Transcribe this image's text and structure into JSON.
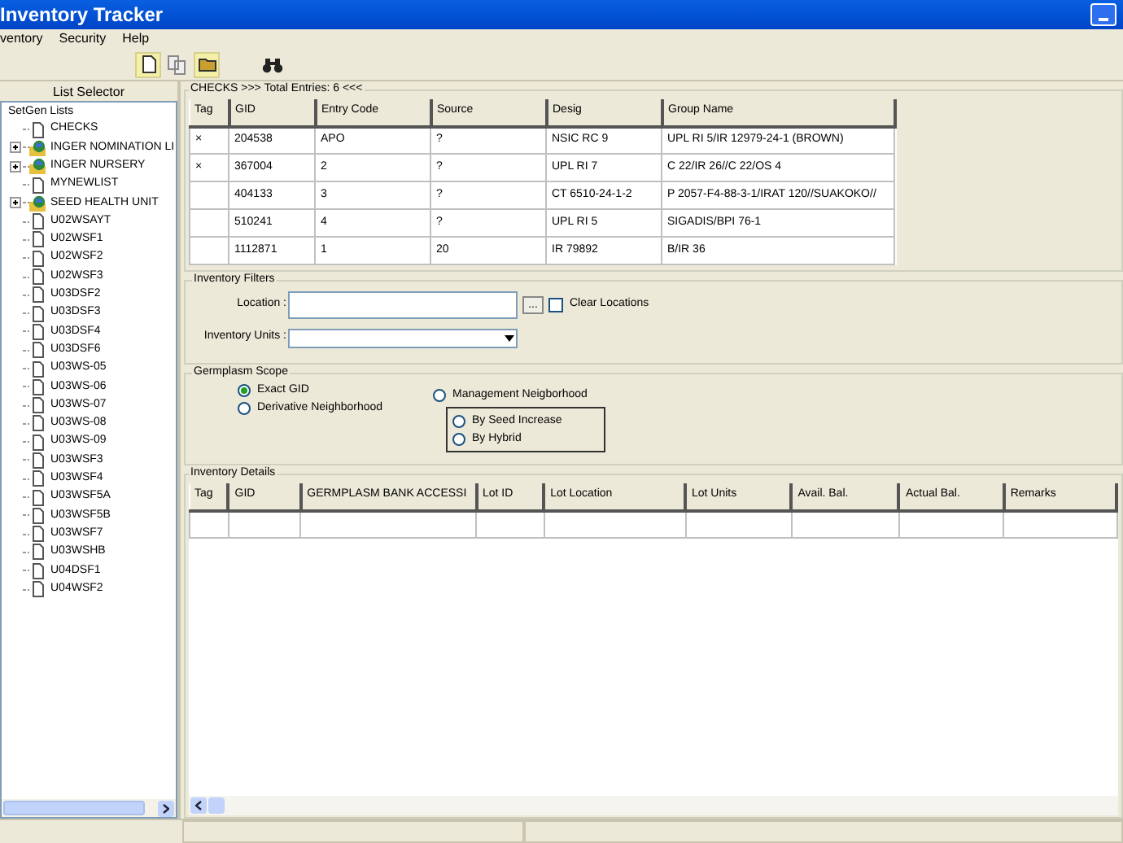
{
  "window": {
    "title": "Inventory Tracker"
  },
  "menu": [
    "ventory",
    "Security",
    "Help"
  ],
  "list_selector": {
    "title": "List Selector",
    "root": "SetGen Lists",
    "items": [
      {
        "label": "CHECKS",
        "kind": "list"
      },
      {
        "label": "INGER NOMINATION LI",
        "kind": "group",
        "expanded": false
      },
      {
        "label": "INGER NURSERY",
        "kind": "group",
        "expanded": false
      },
      {
        "label": "MYNEWLIST",
        "kind": "list"
      },
      {
        "label": "SEED HEALTH UNIT",
        "kind": "group",
        "expanded": false
      },
      {
        "label": "U02WSAYT",
        "kind": "list"
      },
      {
        "label": "U02WSF1",
        "kind": "list"
      },
      {
        "label": "U02WSF2",
        "kind": "list"
      },
      {
        "label": "U02WSF3",
        "kind": "list"
      },
      {
        "label": "U03DSF2",
        "kind": "list"
      },
      {
        "label": "U03DSF3",
        "kind": "list"
      },
      {
        "label": "U03DSF4",
        "kind": "list"
      },
      {
        "label": "U03DSF6",
        "kind": "list"
      },
      {
        "label": "U03WS-05",
        "kind": "list"
      },
      {
        "label": "U03WS-06",
        "kind": "list"
      },
      {
        "label": "U03WS-07",
        "kind": "list"
      },
      {
        "label": "U03WS-08",
        "kind": "list"
      },
      {
        "label": "U03WS-09",
        "kind": "list"
      },
      {
        "label": "U03WSF3",
        "kind": "list"
      },
      {
        "label": "U03WSF4",
        "kind": "list"
      },
      {
        "label": "U03WSF5A",
        "kind": "list"
      },
      {
        "label": "U03WSF5B",
        "kind": "list"
      },
      {
        "label": "U03WSF7",
        "kind": "list"
      },
      {
        "label": "U03WSHB",
        "kind": "list"
      },
      {
        "label": "U04DSF1",
        "kind": "list"
      },
      {
        "label": "U04WSF2",
        "kind": "list"
      }
    ]
  },
  "checks": {
    "title": "CHECKS >>> Total Entries: 6 <<<",
    "columns": [
      "Tag",
      "GID",
      "Entry Code",
      "Source",
      "Desig",
      "Group Name"
    ],
    "rows": [
      [
        "×",
        "204538",
        "APO",
        "?",
        "NSIC RC 9",
        "UPL RI 5/IR 12979-24-1 (BROWN)"
      ],
      [
        "×",
        "367004",
        "2",
        "?",
        "UPL RI 7",
        "C 22/IR 26//C 22/OS 4"
      ],
      [
        "",
        "404133",
        "3",
        "?",
        "CT 6510-24-1-2",
        "P 2057-F4-88-3-1/IRAT 120//SUAKOKO//"
      ],
      [
        "",
        "510241",
        "4",
        "?",
        "UPL RI 5",
        "SIGADIS/BPI 76-1"
      ],
      [
        "",
        "1112871",
        "1",
        "20",
        "IR 79892",
        "B/IR 36"
      ]
    ]
  },
  "inventory_filters": {
    "title": "Inventory Filters",
    "location_label": "Location :",
    "browse": "...",
    "clear_locations": {
      "label": "Clear Locations",
      "checked": false
    },
    "units_label": "Inventory Units :"
  },
  "germplasm_scope": {
    "title": "Germplasm Scope",
    "options": [
      {
        "label": "Exact GID",
        "selected": true
      },
      {
        "label": "Derivative Neighborhood",
        "selected": false
      },
      {
        "label": "Management Neigborhood",
        "selected": false
      }
    ],
    "sub_options": [
      {
        "label": "By Seed Increase",
        "selected": false
      },
      {
        "label": "By Hybrid",
        "selected": false
      }
    ]
  },
  "inventory_details": {
    "title": "Inventory Details",
    "columns": [
      "Tag",
      "GID",
      "GERMPLASM BANK ACCESSI",
      "Lot ID",
      "Lot Location",
      "Lot Units",
      "Avail. Bal.",
      "Actual Bal.",
      "Remarks"
    ]
  }
}
